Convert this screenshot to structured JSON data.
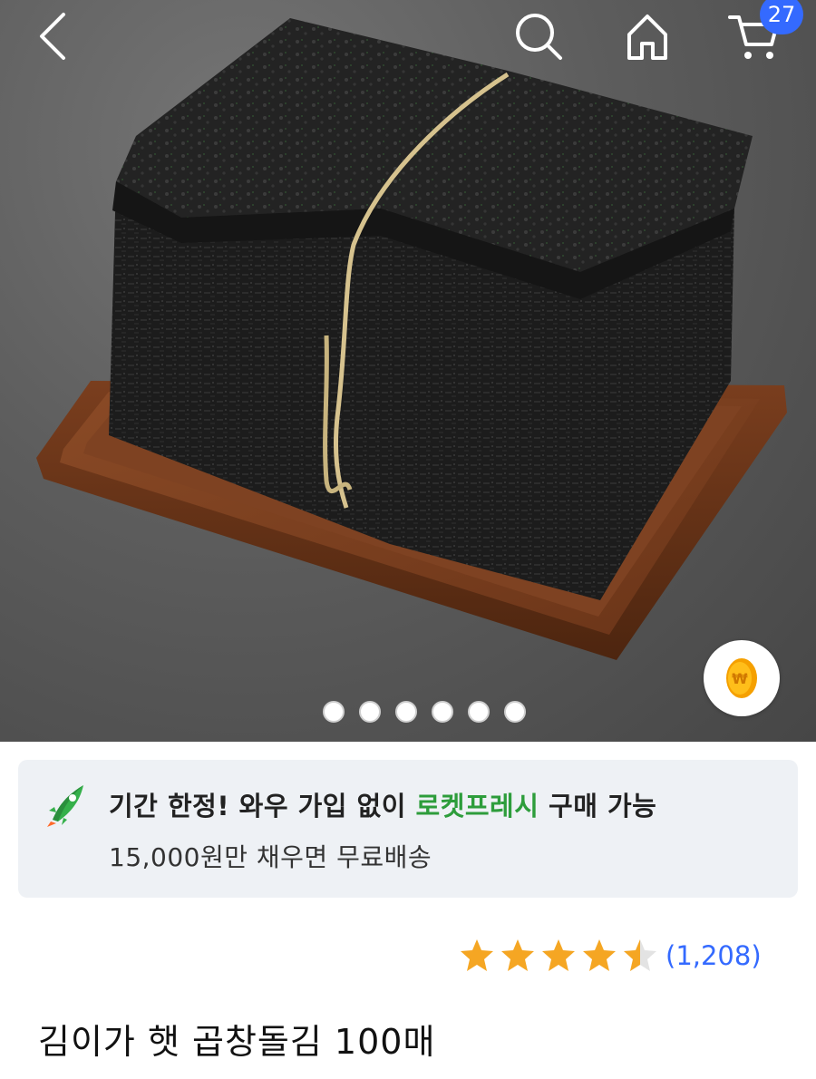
{
  "header": {
    "back_icon": "chevron-left-icon",
    "search_icon": "search-icon",
    "home_icon": "home-icon",
    "cart_icon": "cart-icon",
    "cart_count": "27",
    "badge_color": "#346aff"
  },
  "gallery": {
    "image_count": 6,
    "dot_color": "#ffffff",
    "floating_icon": "won-coin-icon"
  },
  "promo": {
    "icon": "rocket-icon",
    "line1_prefix": "기간 한정! 와우 가입 없이 ",
    "line1_highlight": "로켓프레시",
    "line1_suffix": " 구매 가능",
    "line2": "15,000원만 채우면 무료배송",
    "highlight_color": "#2d9d3b",
    "background": "#eef1f5"
  },
  "rating": {
    "stars": 4.5,
    "max_stars": 5,
    "review_count": "(1,208)",
    "star_color": "#f5a623",
    "count_color": "#346aff"
  },
  "product": {
    "title": "김이가 햇 곱창돌김 100매"
  }
}
